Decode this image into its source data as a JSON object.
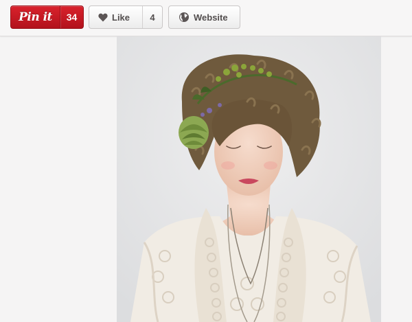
{
  "toolbar": {
    "pin": {
      "label": "Pin it",
      "count": "34",
      "icon": "pinterest-wordmark",
      "color": "#cb2027"
    },
    "like": {
      "label": "Like",
      "count": "4",
      "icon": "heart-icon"
    },
    "website": {
      "label": "Website",
      "icon": "globe-icon"
    }
  },
  "photo": {
    "subject": "woman with curly hair wearing a flower crown and a lace dress",
    "background_color": "#e6e7e8"
  }
}
